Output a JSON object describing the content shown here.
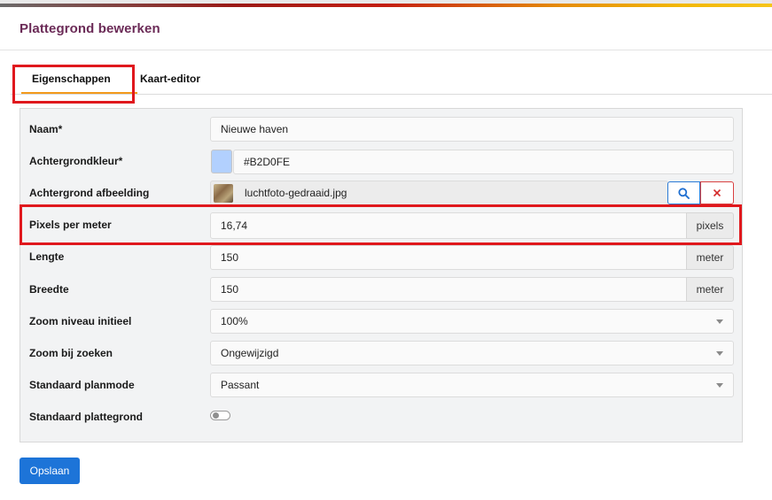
{
  "page": {
    "title": "Plattegrond bewerken"
  },
  "tabs": [
    {
      "label": "Eigenschappen",
      "active": true
    },
    {
      "label": "Kaart-editor",
      "active": false
    }
  ],
  "form": {
    "name": {
      "label": "Naam*",
      "value": "Nieuwe haven"
    },
    "background_color": {
      "label": "Achtergrondkleur*",
      "value": "#B2D0FE",
      "swatch": "#B2D0FE"
    },
    "background_image": {
      "label": "Achtergrond afbeelding",
      "value": "luchtfoto-gedraaid.jpg",
      "search_icon": "search-icon",
      "clear_icon": "close-icon"
    },
    "pixels_per_meter": {
      "label": "Pixels per meter",
      "value": "16,74",
      "unit": "pixels"
    },
    "length": {
      "label": "Lengte",
      "value": "150",
      "unit": "meter"
    },
    "width": {
      "label": "Breedte",
      "value": "150",
      "unit": "meter"
    },
    "zoom_initial": {
      "label": "Zoom niveau initieel",
      "value": "100%"
    },
    "zoom_search": {
      "label": "Zoom bij zoeken",
      "value": "Ongewijzigd"
    },
    "default_planmode": {
      "label": "Standaard planmode",
      "value": "Passant"
    },
    "default_floorplan": {
      "label": "Standaard plattegrond",
      "checked": false
    }
  },
  "actions": {
    "save_label": "Opslaan"
  },
  "colors": {
    "title": "#6b2b57",
    "accent_tab": "#f29a1c",
    "highlight": "#e0181d",
    "primary": "#1d74d8"
  }
}
